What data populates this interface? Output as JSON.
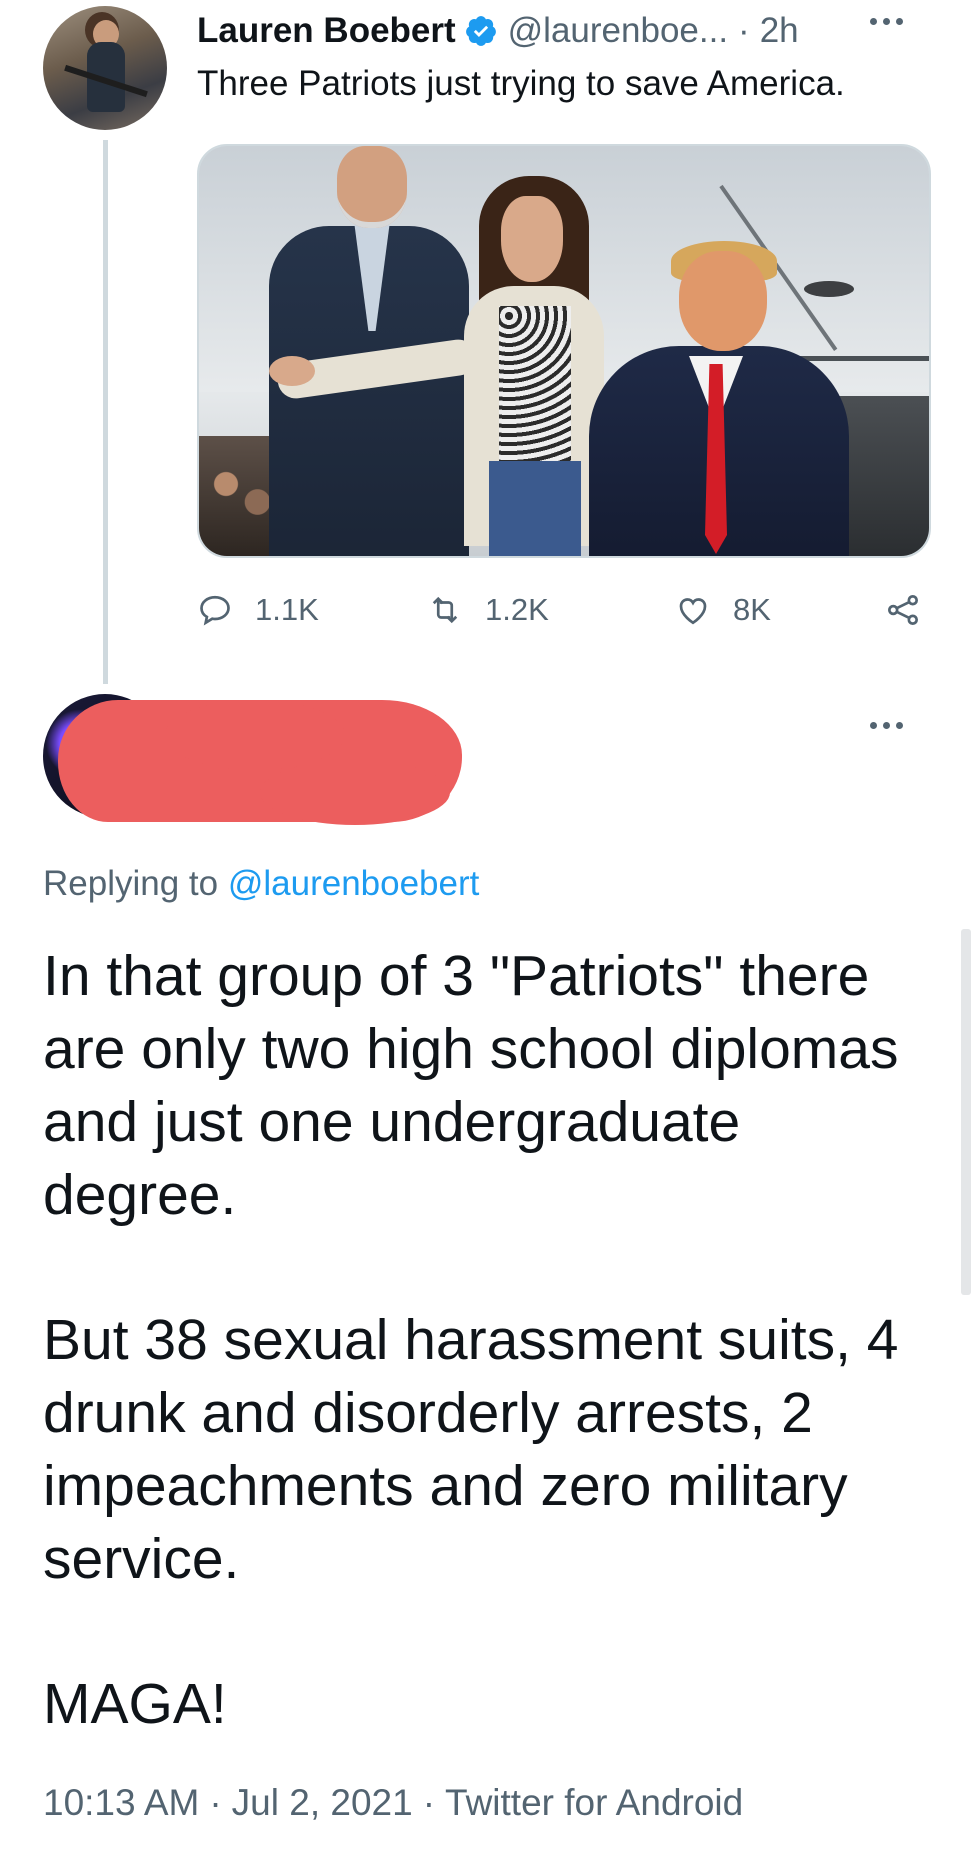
{
  "parent_tweet": {
    "display_name": "Lauren Boebert",
    "verified": true,
    "handle": "@laurenboe...",
    "separator": "·",
    "time_ago": "2h",
    "text": "Three Patriots just trying to save America.",
    "stats": {
      "replies": "1.1K",
      "retweets": "1.2K",
      "likes": "8K"
    }
  },
  "reply_tweet": {
    "replying_prefix": "Replying to",
    "replying_mention": "@laurenboebert",
    "body": {
      "line1": "In that group of 3 \"Patriots\" there are only two high school diplomas and just one undergraduate degree.",
      "line2": "But 38 sexual harassment suits, 4 drunk and disorderly arrests, 2 impeachments and zero military service.",
      "line3": "MAGA!"
    },
    "time": "10:13 AM",
    "date": "Jul 2, 2021",
    "client": "Twitter for Android",
    "footer_separator": "·"
  },
  "colors": {
    "text": "#0f1419",
    "muted": "#536471",
    "accent": "#1d9bf0",
    "redaction": "#ec5e5e"
  },
  "icons": [
    "verified-badge-icon",
    "more-icon",
    "reply-icon",
    "retweet-icon",
    "like-icon",
    "share-icon"
  ]
}
